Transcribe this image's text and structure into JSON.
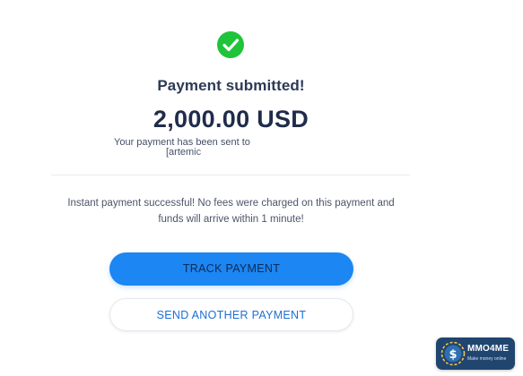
{
  "confirmation": {
    "icon": "check-circle-icon",
    "icon_color": "#1fc43a",
    "title": "Payment submitted!",
    "amount": "2,000.00 USD",
    "sent_to_text": "Your payment has been sent to",
    "recipient_partial": "[artemic",
    "note_line1": "Instant payment successful! No fees were charged on this payment and",
    "note_line2": "funds will arrive within 1 minute!"
  },
  "actions": {
    "track_label": "TRACK PAYMENT",
    "send_another_label": "SEND ANOTHER PAYMENT",
    "primary_color": "#1c86f2"
  },
  "watermark": {
    "name": "MMO4ME",
    "tagline": "Make money online",
    "bg_color": "#20456f"
  }
}
